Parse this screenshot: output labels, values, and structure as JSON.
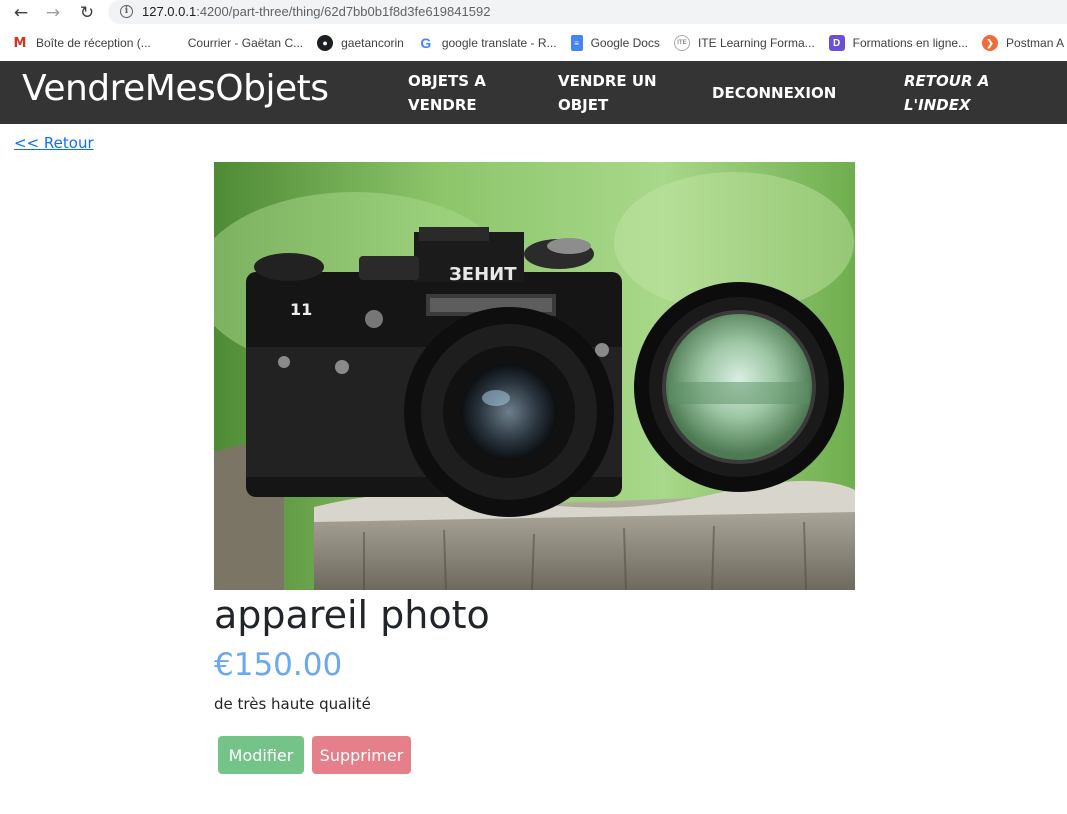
{
  "browser": {
    "url_host": "127.0.0.1",
    "url_rest": ":4200/part-three/thing/62d7bb0b1f8d3fe619841592",
    "bookmarks": [
      {
        "label": "Boîte de réception (...",
        "icon": "gmail-icon"
      },
      {
        "label": "Courrier - Gaëtan C...",
        "icon": "microsoft-icon"
      },
      {
        "label": "gaetancorin",
        "icon": "github-icon"
      },
      {
        "label": "google translate - R...",
        "icon": "google-icon"
      },
      {
        "label": "Google Docs",
        "icon": "google-docs-icon"
      },
      {
        "label": "ITE Learning Forma...",
        "icon": "ite-icon"
      },
      {
        "label": "Formations en ligne...",
        "icon": "formations-icon"
      },
      {
        "label": "Postman A",
        "icon": "postman-icon"
      }
    ]
  },
  "navbar": {
    "brand": "VendreMesObjets",
    "links": {
      "objects_for_sale": "Objets a vendre",
      "sell_object": "Vendre un objet",
      "logout": "Deconnexion",
      "back_to_index": "Retour a l'index"
    }
  },
  "page": {
    "back_link": "<< Retour",
    "product": {
      "title": "appareil photo",
      "price": "€150.00",
      "description": "de très haute qualité",
      "image_alt": "camera-photo"
    },
    "buttons": {
      "edit": "Modifier",
      "delete": "Supprimer"
    }
  },
  "colors": {
    "navbar_bg": "#343434",
    "price": "#6aa8ef",
    "edit_button": "#74c48a",
    "delete_button": "#e57f8a",
    "link": "#0d6efd"
  }
}
